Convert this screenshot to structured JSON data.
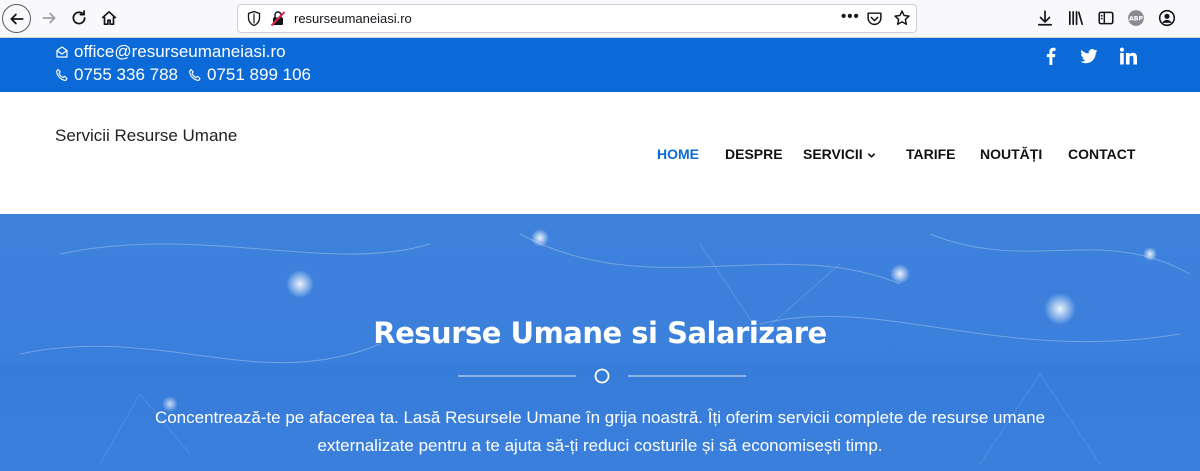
{
  "browser": {
    "url": "resurseumaneiasi.ro",
    "more_label": "•••"
  },
  "topbar": {
    "email": "office@resurseumaneiasi.ro",
    "phone1": "0755 336 788",
    "phone2": "0751 899 106",
    "social": [
      "facebook-icon",
      "twitter-icon",
      "linkedin-icon"
    ]
  },
  "header": {
    "site_title": "Servicii Resurse Umane",
    "nav": {
      "home": "HOME",
      "despre": "DESPRE",
      "servicii": "SERVICII",
      "tarife": "TARIFE",
      "noutati": "NOUTĂȚI",
      "contact": "CONTACT"
    }
  },
  "hero": {
    "title": "Resurse Umane si Salarizare",
    "text_line1": "Concentrează-te pe afacerea ta. Lasă Resursele Umane în grija noastră. Îți oferim servicii complete de resurse umane",
    "text_line2": "externalizate pentru a te ajuta să-ți reduci costurile și să economisești timp."
  },
  "colors": {
    "brand": "#0b6ad8",
    "hero": "#3f82dc",
    "nav_text": "#111111"
  }
}
